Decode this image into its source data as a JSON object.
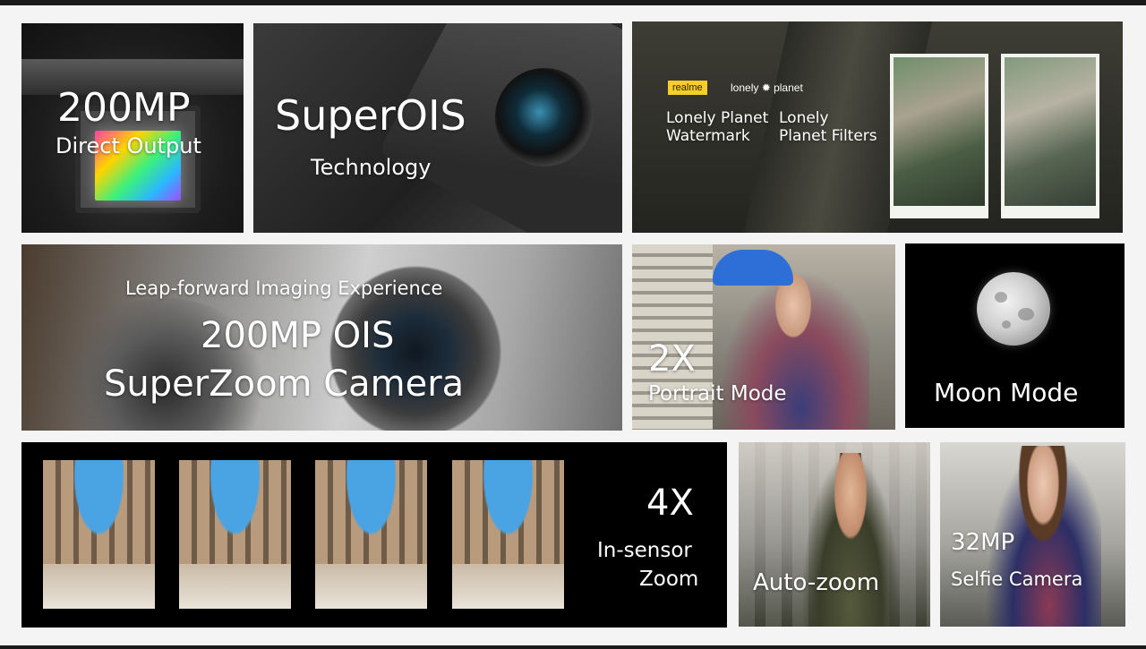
{
  "tiles": {
    "sensor": {
      "title": "200MP",
      "subtitle": "Direct Output"
    },
    "ois": {
      "title": "SuperOIS",
      "subtitle": "Technology"
    },
    "lonely_planet": {
      "badge": "realme",
      "brand": "lonely ✹ planet",
      "left_label_line1": "Lonely Planet",
      "left_label_line2": "Watermark",
      "right_label_line1": "Lonely",
      "right_label_line2": "Planet Filters"
    },
    "superzoom": {
      "tagline": "Leap-forward Imaging Experience",
      "title_line1": "200MP OIS",
      "title_line2": "SuperZoom Camera"
    },
    "portrait": {
      "title": "2X",
      "subtitle": "Portrait Mode"
    },
    "moon": {
      "title": "Moon Mode"
    },
    "insensor": {
      "title": "4X",
      "subtitle_line1": "In-sensor",
      "subtitle_line2": "Zoom"
    },
    "autozoom": {
      "title": "Auto-zoom"
    },
    "selfie": {
      "title": "32MP",
      "subtitle": "Selfie Camera"
    }
  },
  "colors": {
    "badge_yellow": "#f7cd27",
    "moon_bg": "#000000",
    "sky_blue": "#4aa3e3"
  }
}
